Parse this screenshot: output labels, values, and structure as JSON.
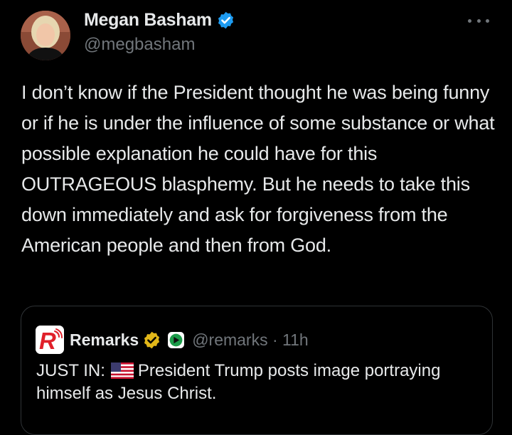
{
  "author": {
    "name": "Megan Basham",
    "handle": "@megbasham"
  },
  "tweet": {
    "text": "I don’t know if the President thought he was being funny or if he is under the influence of some substance or what possible explanation he could have for this OUTRAGEOUS blasphemy. But he needs to take this down immediately and ask for forgiveness from the American people and then from God."
  },
  "quoted_tweet": {
    "author_name": "Remarks",
    "handle_time": "@remarks · 11h",
    "text_prefix": "JUST IN:",
    "text_rest": "President Trump posts image portraying himself as Jesus Christ."
  },
  "icons": {
    "verified": "verified-check-icon",
    "gold_badge": "gold-org-badge-icon",
    "affiliate": "affiliate-badge-icon",
    "flag": "us-flag-icon",
    "more": "more-options-icon"
  },
  "colors": {
    "background": "#000000",
    "text": "#e7e9ea",
    "secondary_text": "#71767b",
    "verified_blue": "#1d9bf0",
    "gold": "#e2b719",
    "remarks_red": "#e0202a"
  }
}
